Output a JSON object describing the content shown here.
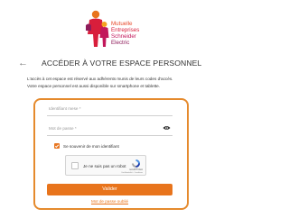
{
  "brand": {
    "logo_lines": [
      "Mutuelle",
      "Entreprises",
      "Schneider",
      "Electric"
    ]
  },
  "header": {
    "title": "ACCÉDER À VOTRE ESPACE PERSONNEL",
    "intro_lines": [
      "L'accès à cet espace est réservé aux adhérents munis de leurs codes d'accès.",
      "Votre espace personnel est aussi disponible sur smartphone et tablette."
    ]
  },
  "form": {
    "login_placeholder": "Identifiant mese *",
    "password_placeholder": "Mot de passe *",
    "remember_label": "Se souvenir de mon identifiant",
    "remember_checked": true,
    "captcha_label": "Je ne suis pas un robot",
    "captcha_brand": "reCAPTCHA",
    "captcha_terms": "Confidentialité - Conditions",
    "submit_label": "Valider",
    "forgot_label": "Mot de passe oublié"
  },
  "colors": {
    "accent": "#e8741c",
    "highlight_border": "#e58a2d"
  }
}
